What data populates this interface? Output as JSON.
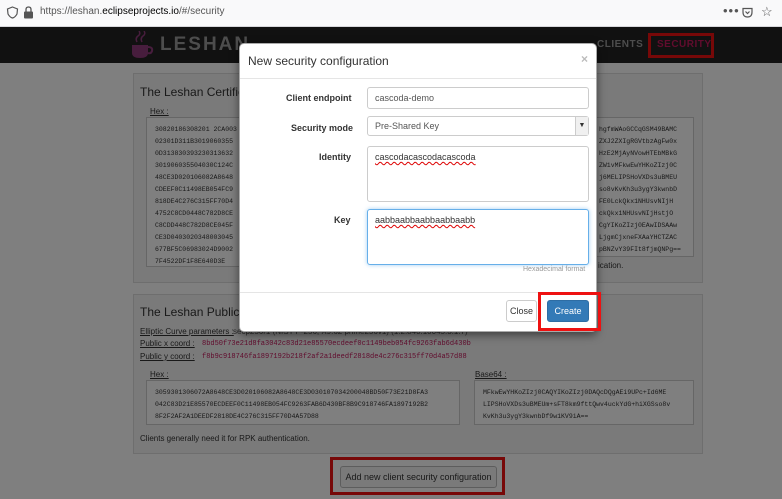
{
  "browser": {
    "url_prefix": "https://leshan.",
    "url_domain": "eclipseprojects.io",
    "url_suffix": "/#/security",
    "menu_dots": "•••"
  },
  "navbar": {
    "brand": "LESHAN",
    "items": [
      {
        "label": "CLIENTS"
      },
      {
        "label": "SECURITY",
        "active": true
      }
    ]
  },
  "certificate_panel": {
    "title": "The Leshan Certifica",
    "hex_label": "Hex :",
    "hex_lines": [
      "30820186308201 2CA003",
      "02301D311B3019060355",
      "0D313830393230313632",
      "301906035504030C124C",
      "48CE3D020106082A8648",
      "CDEEF0C11498EB054FC9",
      "818DE4C276C315FF70D4",
      "4752C8CD0448C782D8CE",
      "C8CDD448C782D8CE045F",
      "CE3D0403020348003045",
      "677BF5C06983024D9002",
      "7F4522DF1F8E640D3E"
    ],
    "b64_lines": [
      "hgfmWAoGCCqGSM49BAMC",
      "ZXJ2ZXIgRGVtbzAgFw0x",
      "HzE2MjAyNVowHTEbMBkG",
      "ZW1vMFkwEwYHKoZIzj0C",
      "j6MELIPSHoVXDs3uBMEU",
      "so8vKvKh3u3ygY3kwnbD",
      "FE0LckQkx1NHUsvNIjH",
      "ckQkx1NHUsvNIjHstjO",
      "CgYIKoZIzj0EAwIDSAAw",
      "LjgmCjxneFXAaYHCTZAC",
      "pBNZvY39FIt8fjmQNPg=="
    ],
    "note_fragment": "ication."
  },
  "public_key_panel": {
    "title": "The Leshan Public K",
    "ec_params_label": "Elliptic Curve parameters :",
    "ec_params_value": "secp256r1 (NIST P-256, X9.62 prime256v1) (1.2.840.10045.3.1.7)",
    "x_label": "Public x coord :",
    "x_value": "8bd50f73e21d8fa3042c83d21e85570ecdeef0c1149beb054fc9263fab6d430b",
    "y_label": "Public y coord :",
    "y_value": "f8b9c918746fa1897192b218f2af2a1deedf2818de4c276c315ff70d4a57d88",
    "hex_label": "Hex :",
    "hex_value": "3059301306072A8648CE3D020106082A8648CE3D030107034200048BD50F73E21D8FA3\n042C83D21E85570ECDEEF0C11498EB054FC9263FAB6D430BF8B9C918746FA1897192B2\n8F2F2AF2A1DEEDF2818DE4C276C315FF70D4A57D88",
    "b64_label": "Base64 :",
    "b64_value": "MFkwEwYHKoZIzj0CAQYIKoZIzj0DAQcDQgAEi9UPc+Id6ME\nLIPSHoVXDs3uBMEUm+sFT8km9fttQwv4uckYdG+hiXGSso8v\nKvKh3u3ygY3kwnbDf9w1KV9iA==",
    "note": "Clients generally need it for RPK authentication."
  },
  "add_button_label": "Add new client security configuration",
  "modal": {
    "title": "New security configuration",
    "close_glyph": "×",
    "fields": {
      "endpoint_label": "Client endpoint",
      "endpoint_value": "cascoda-demo",
      "mode_label": "Security mode",
      "mode_value": "Pre-Shared Key",
      "identity_label": "Identity",
      "identity_value": "cascodacascodacascoda",
      "key_label": "Key",
      "key_value": "aabbaabbaabbaabbaabb",
      "key_hint": "Hexadecimal format"
    },
    "buttons": {
      "close": "Close",
      "create": "Create"
    }
  },
  "colors": {
    "navbar_bg": "#222222",
    "accent_pink": "#c2185b",
    "primary_blue": "#337ab7",
    "highlight_red": "#ee1111"
  }
}
